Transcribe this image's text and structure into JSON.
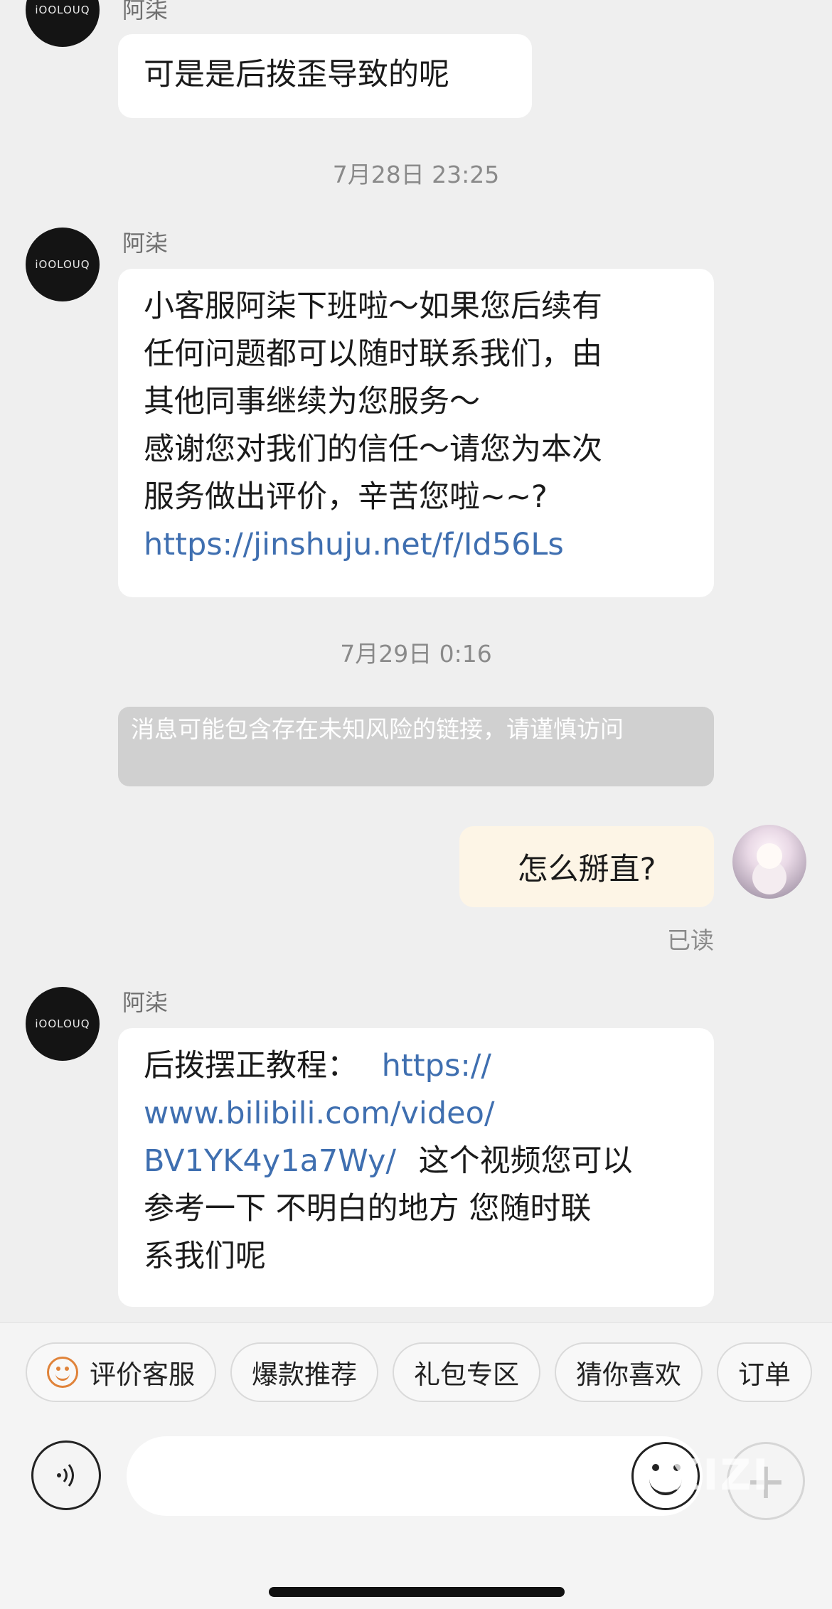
{
  "messages": {
    "m1": {
      "logo": "iOOLOUQ",
      "sender": "阿柒",
      "text": "可是是后拨歪导致的呢"
    },
    "t1": "7月28日 23:25",
    "m2": {
      "logo": "iOOLOUQ",
      "sender": "阿柒",
      "line1": "小客服阿柒下班啦～如果您后续有",
      "line2": "任何问题都可以随时联系我们，由",
      "line3": "其他同事继续为您服务～",
      "line4": "感谢您对我们的信任～请您为本次",
      "line5": "服务做出评价，辛苦您啦~~?",
      "link": "https://jinshuju.net/f/Id56Ls"
    },
    "t2": "7月29日 0:16",
    "warning": "消息可能包含存在未知风险的链接，请谨慎访问",
    "mine": {
      "text": "怎么掰直?",
      "status": "已读"
    },
    "m3": {
      "logo": "iOOLOUQ",
      "sender": "阿柒",
      "prefix": "后拨摆正教程：",
      "link1": "https://",
      "link2": "www.bilibili.com/video/",
      "link3": "BV1YK4y1a7Wy/",
      "suffix1": "这个视频您可以",
      "suffix2": "参考一下  不明白的地方 您随时联",
      "suffix3": "系我们呢"
    }
  },
  "quick_replies": [
    "评价客服",
    "爆款推荐",
    "礼包专区",
    "猜你喜欢",
    "订单"
  ],
  "input": {
    "placeholder": "",
    "voice_icon": "voice-icon",
    "emoji_icon": "emoji-icon",
    "plus_icon": "plus-icon"
  },
  "watermark": "XIZI",
  "colors": {
    "link": "#3f6fb0",
    "my_bubble": "#fdf5e6",
    "accent_icon": "#e0833a"
  }
}
